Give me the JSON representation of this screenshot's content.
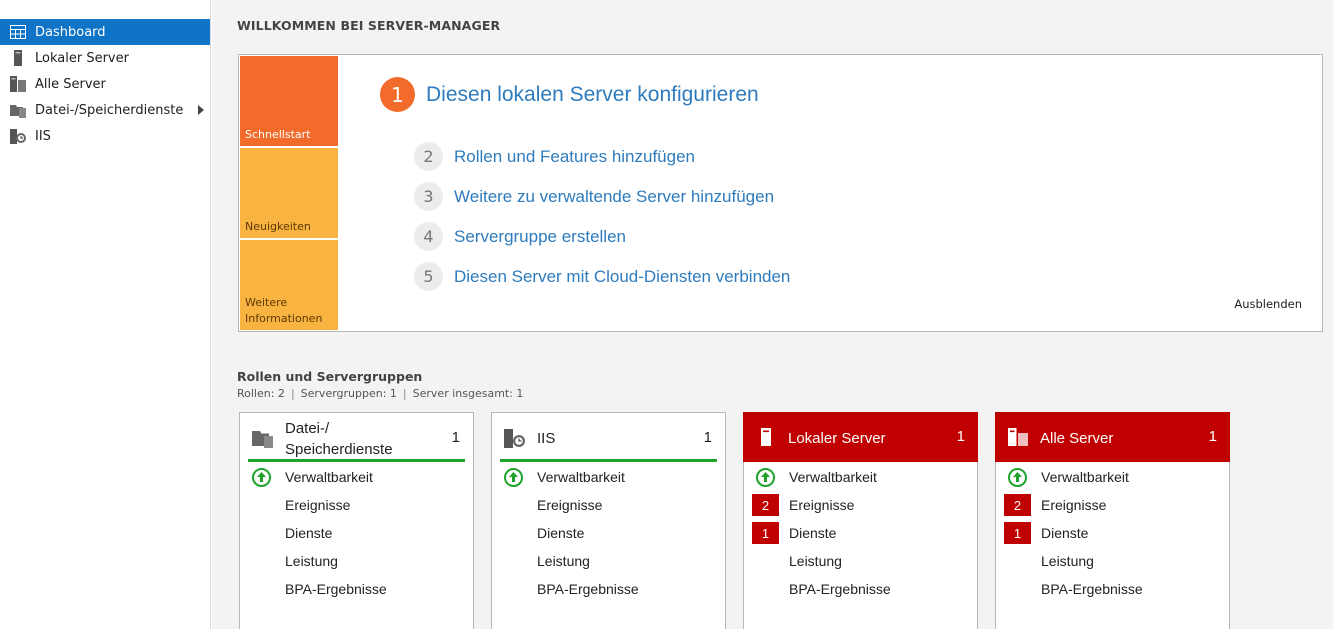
{
  "sidebar": {
    "items": [
      {
        "label": "Dashboard",
        "icon": "dashboard-icon"
      },
      {
        "label": "Lokaler Server",
        "icon": "server-icon"
      },
      {
        "label": "Alle Server",
        "icon": "servers-icon"
      },
      {
        "label": "Datei-/Speicherdienste",
        "icon": "file-storage-icon"
      },
      {
        "label": "IIS",
        "icon": "iis-icon"
      }
    ]
  },
  "welcome": {
    "title": "WILLKOMMEN BEI SERVER-MANAGER",
    "tiles": [
      "Schnellstart",
      "Neuigkeiten",
      "Weitere Informationen"
    ],
    "steps": [
      {
        "num": "1",
        "label": "Diesen lokalen Server konfigurieren"
      },
      {
        "num": "2",
        "label": "Rollen und Features hinzufügen"
      },
      {
        "num": "3",
        "label": "Weitere zu verwaltende Server hinzufügen"
      },
      {
        "num": "4",
        "label": "Servergruppe erstellen"
      },
      {
        "num": "5",
        "label": "Diesen Server mit Cloud-Diensten verbinden"
      }
    ],
    "hide_label": "Ausblenden"
  },
  "roles": {
    "title": "Rollen und Servergruppen",
    "summary": {
      "roles": "Rollen: 2",
      "groups": "Servergruppen: 1",
      "servers": "Server insgesamt: 1"
    },
    "cards": [
      {
        "title_line1": "Datei-/",
        "title_line2": "Speicherdienste",
        "count": "1",
        "rows": [
          {
            "label": "Verwaltbarkeit",
            "badge": ""
          },
          {
            "label": "Ereignisse",
            "badge": ""
          },
          {
            "label": "Dienste",
            "badge": ""
          },
          {
            "label": "Leistung",
            "badge": ""
          },
          {
            "label": "BPA-Ergebnisse",
            "badge": ""
          }
        ]
      },
      {
        "title": "IIS",
        "count": "1",
        "rows": [
          {
            "label": "Verwaltbarkeit",
            "badge": ""
          },
          {
            "label": "Ereignisse",
            "badge": ""
          },
          {
            "label": "Dienste",
            "badge": ""
          },
          {
            "label": "Leistung",
            "badge": ""
          },
          {
            "label": "BPA-Ergebnisse",
            "badge": ""
          }
        ]
      },
      {
        "title": "Lokaler Server",
        "count": "1",
        "rows": [
          {
            "label": "Verwaltbarkeit",
            "badge": ""
          },
          {
            "label": "Ereignisse",
            "badge": "2"
          },
          {
            "label": "Dienste",
            "badge": "1"
          },
          {
            "label": "Leistung",
            "badge": ""
          },
          {
            "label": "BPA-Ergebnisse",
            "badge": ""
          }
        ]
      },
      {
        "title": "Alle Server",
        "count": "1",
        "rows": [
          {
            "label": "Verwaltbarkeit",
            "badge": ""
          },
          {
            "label": "Ereignisse",
            "badge": "2"
          },
          {
            "label": "Dienste",
            "badge": "1"
          },
          {
            "label": "Leistung",
            "badge": ""
          },
          {
            "label": "BPA-Ergebnisse",
            "badge": ""
          }
        ]
      }
    ]
  },
  "colors": {
    "accent_blue": "#0f73c8",
    "link_blue": "#2e7bbd",
    "quickstart_orange": "#f26b2a",
    "tile_yellow": "#f9b341",
    "alert_red": "#c00000",
    "ok_green": "#1fa32a"
  }
}
